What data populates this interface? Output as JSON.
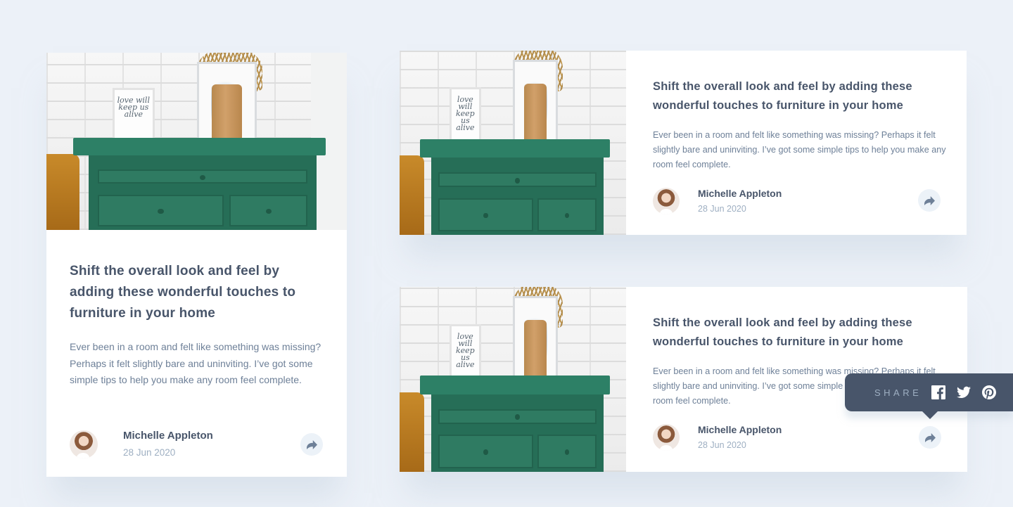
{
  "article": {
    "title": "Shift the overall look and feel by adding these wonderful touches to furniture in your home",
    "description": "Ever been in a room and felt like something was missing? Perhaps it felt slightly bare and uninviting. I’ve got some simple tips to help you make any room feel complete.",
    "author": "Michelle Appleton",
    "date": "28 Jun 2020",
    "image_frame_text": "love will keep us alive"
  },
  "share_tooltip": {
    "label": "SHARE",
    "icons": [
      "facebook-icon",
      "twitter-icon",
      "pinterest-icon"
    ]
  },
  "colors": {
    "background": "#ecf1f8",
    "title": "#48556a",
    "text": "#6e8098",
    "muted": "#9eafc2",
    "tooltip_bg": "#48556a",
    "share_button_bg": "#ecf2f8"
  }
}
